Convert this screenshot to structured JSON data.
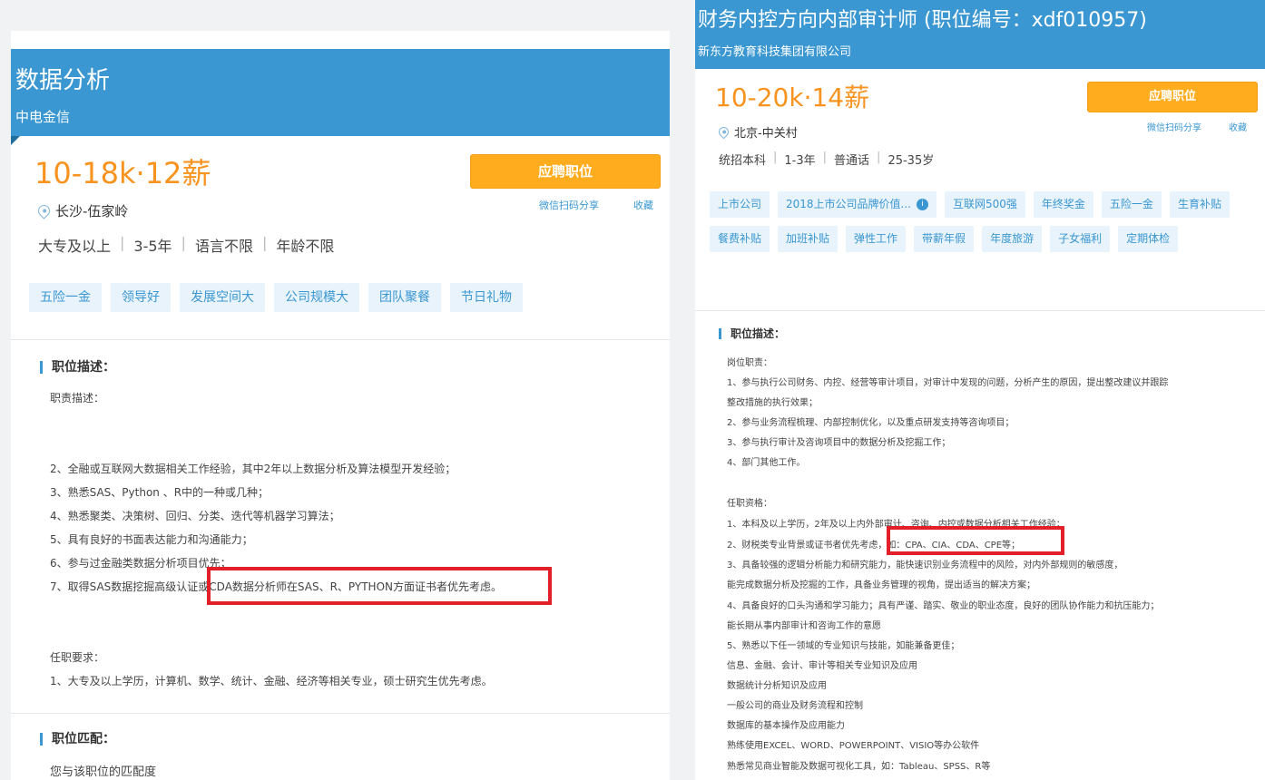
{
  "left_job": {
    "title": "数据分析",
    "company": "中电金信",
    "salary": "10-18k·12薪",
    "apply_label": "应聘职位",
    "share_label": "微信扫码分享",
    "fav_label": "收藏",
    "location": "长沙-伍家岭",
    "requirements": [
      "大专及以上",
      "3-5年",
      "语言不限",
      "年龄不限"
    ],
    "tags": [
      "五险一金",
      "领导好",
      "发展空间大",
      "公司规模大",
      "团队聚餐",
      "节日礼物"
    ],
    "section_desc_title": "职位描述：",
    "desc_lines": [
      "职责描述：",
      "2、全融或互联网大数据相关工作经验，其中2年以上数据分析及算法模型开发经验；",
      "3、熟悉SAS、Python 、R中的一种或几种；",
      "4、熟悉聚类、决策树、回归、分类、迭代等机器学习算法；",
      "5、具有良好的书面表达能力和沟通能力；",
      "6、参与过金融类数据分析项目优先；",
      "7、取得SAS数据挖掘高级认证或CDA数据分析师在SAS、R、PYTHON方面证书者优先考虑。",
      "任职要求：",
      "1、大专及以上学历，计算机、数学、统计、金融、经济等相关专业，硕士研究生优先考虑。"
    ],
    "section_fit_title": "职位匹配：",
    "fit_line": "您与该职位的匹配度"
  },
  "right_job": {
    "title": "财务内控方向内部审计师 (职位编号：xdf010957)",
    "company": "新东方教育科技集团有限公司",
    "salary": "10-20k·14薪",
    "apply_label": "应聘职位",
    "share_label": "微信扫码分享",
    "fav_label": "收藏",
    "location": "北京-中关村",
    "requirements": [
      "统招本科",
      "1-3年",
      "普通话",
      "25-35岁"
    ],
    "tags": [
      "上市公司",
      "2018上市公司品牌价值...",
      "互联网500强",
      "年终奖金",
      "五险一金",
      "生育补贴",
      "餐费补贴",
      "加班补贴",
      "弹性工作",
      "带薪年假",
      "年度旅游",
      "子女福利",
      "定期体检"
    ],
    "section_desc_title": "职位描述：",
    "desc_lines": [
      "岗位职责：",
      "1、参与执行公司财务、内控、经营等审计项目，对审计中发现的问题，分析产生的原因，提出整改建议并跟踪",
      "整改措施的执行效果；",
      "2、参与业务流程梳理、内部控制优化，以及重点研发支持等咨询项目；",
      "3、参与执行审计及咨询项目中的数据分析及挖掘工作；",
      "4、部门其他工作。",
      "任职资格：",
      "1、本科及以上学历，2年及以上内外部审计、咨询、内控或数据分析相关工作经验；",
      "2、财税类专业背景或证书者优先考虑，如：CPA、CIA、CDA、CPE等；",
      "3、具备较强的逻辑分析能力和研究能力，能快速识别业务流程中的风险，对内外部规则的敏感度，",
      "能完成数据分析及挖掘的工作，具备业务管理的视角，提出适当的解决方案；",
      "4、具备良好的口头沟通和学习能力；具有严谨、踏实、敬业的职业态度，良好的团队协作能力和抗压能力；",
      "能长期从事内部审计和咨询工作的意愿",
      "5、熟悉以下任一领域的专业知识与技能，如能兼备更佳；",
      "信息、金融、会计、审计等相关专业知识及应用",
      "数据统计分析知识及应用",
      "一般公司的商业及财务流程和控制",
      "数据库的基本操作及应用能力",
      "熟练使用EXCEL、WORD、POWERPOINT、VISIO等办公软件",
      "熟悉常见商业智能及数据可视化工具，如：Tableau、SPSS、R等"
    ]
  },
  "colors": {
    "banner": "#3a97d1",
    "salary": "#f7931e",
    "apply": "#ffad1f",
    "tag_bg": "#e9f3fb",
    "highlight": "#e2202a"
  }
}
